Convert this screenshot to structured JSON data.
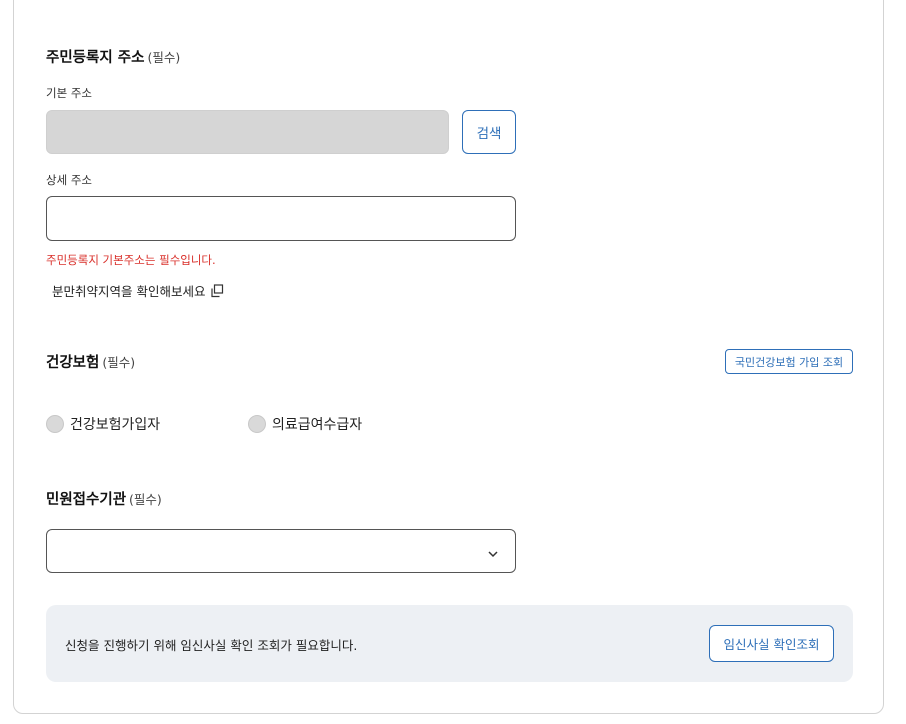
{
  "address": {
    "title": "주민등록지 주소",
    "required": "(필수)",
    "basic_label": "기본 주소",
    "basic_value": "",
    "search_label": "검색",
    "detail_label": "상세 주소",
    "detail_value": "",
    "error": "주민등록지 기본주소는 필수입니다.",
    "check_link": "분만취약지역을 확인해보세요"
  },
  "insurance": {
    "title": "건강보험",
    "required": "(필수)",
    "lookup_label": "국민건강보험 가입 조회",
    "options": [
      "건강보험가입자",
      "의료급여수급자"
    ]
  },
  "agency": {
    "title": "민원접수기관",
    "required": "(필수)",
    "selected": ""
  },
  "notice": {
    "text": "신청을 진행하기 위해 임신사실 확인 조회가 필요합니다.",
    "button_label": "임신사실 확인조회"
  },
  "icons": {
    "copy": "copy-icon",
    "select_arrow": "chevron-down-icon"
  },
  "colors": {
    "accent": "#2e6fb8",
    "error": "#d9302b",
    "disabled_input": "#d6d6d6",
    "notice_bg": "#edf0f4"
  }
}
